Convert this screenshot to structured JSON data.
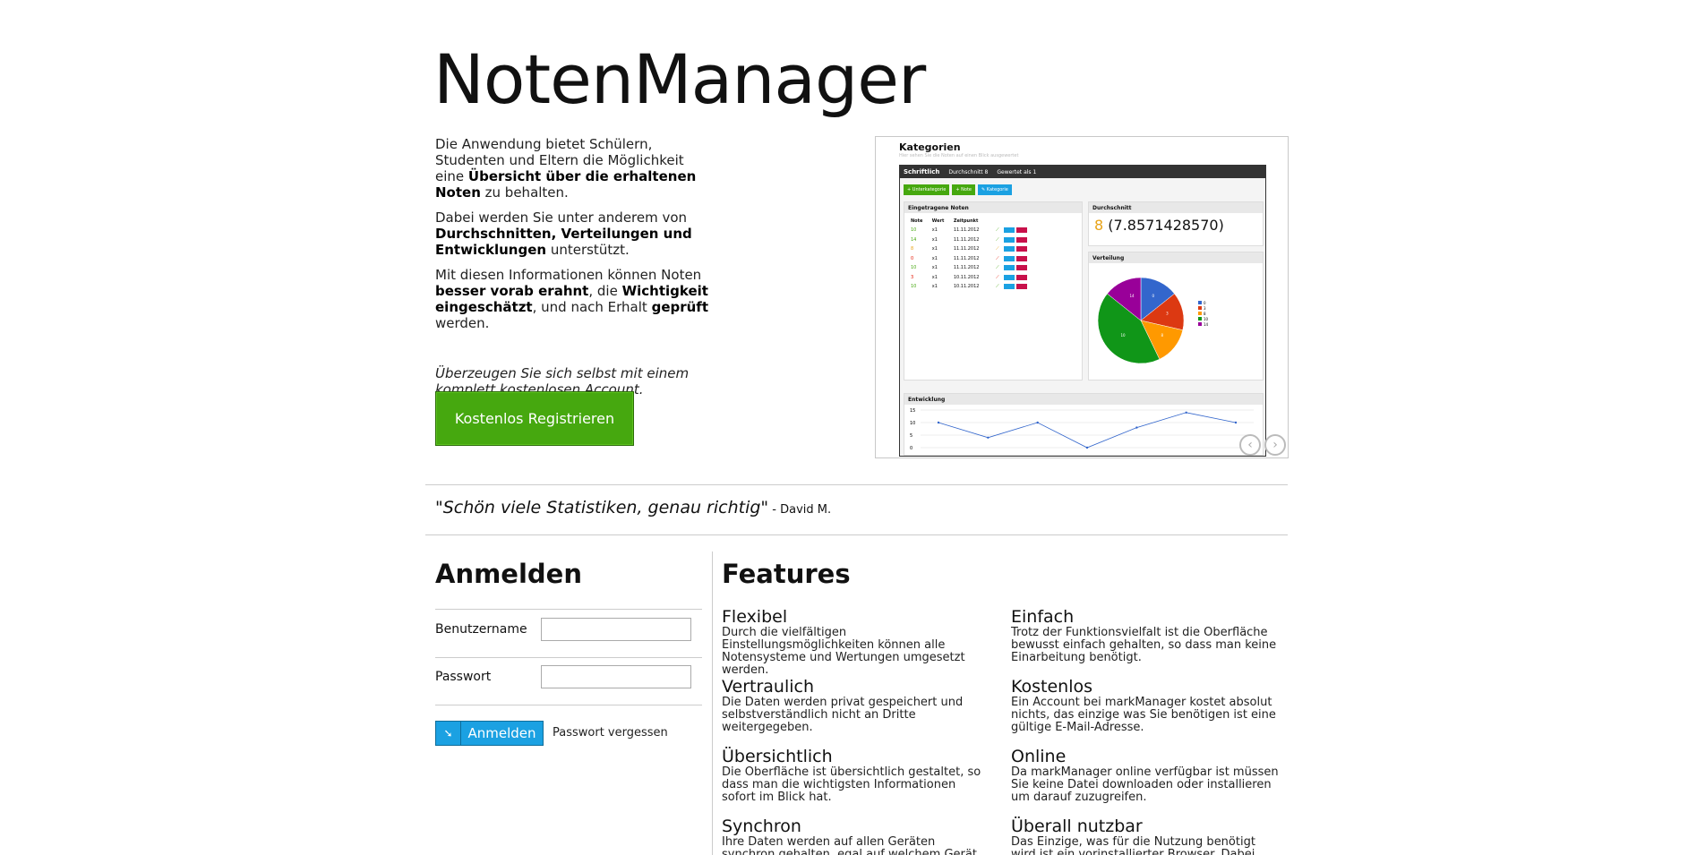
{
  "header": {
    "title": "NotenManager"
  },
  "intro": {
    "p1": [
      "Die Anwendung bietet Schülern, Studenten und Eltern die Möglichkeit eine ",
      "Übersicht über die erhaltenen Noten",
      " zu behalten."
    ],
    "p2": [
      "Dabei werden Sie unter anderem von ",
      "Durchschnitten, Verteilungen und Entwicklungen",
      " unterstützt."
    ],
    "p3": [
      "Mit diesen Informationen können Noten ",
      "besser vorab erahnt",
      ", die ",
      "Wichtigkeit eingeschätzt",
      ", und nach Erhalt ",
      "geprüft",
      " werden."
    ],
    "convince": "Überzeugen Sie sich selbst mit einem komplett kostenlosen Account.",
    "register_label": "Kostenlos Registrieren"
  },
  "preview": {
    "title": "Kategorien",
    "subtitle": "Hier sehen Sie die Noten auf einen Blick ausgewertet",
    "bar": {
      "name": "Schriftlich",
      "avg": "Durchschnitt 8",
      "weight": "Gewertet als 1"
    },
    "buttons": [
      "Unterkategorie",
      "Note",
      "Kategorie"
    ],
    "grades_panel": "Eingetragene Noten",
    "headers": [
      "Note",
      "Wert",
      "Zeitpunkt"
    ],
    "rows": [
      {
        "note": "10",
        "wert": "x1",
        "zeit": "11.11.2012",
        "color": "#46a80f"
      },
      {
        "note": "14",
        "wert": "x1",
        "zeit": "11.11.2012",
        "color": "#46a80f"
      },
      {
        "note": "8",
        "wert": "x1",
        "zeit": "11.11.2012",
        "color": "#e8a317"
      },
      {
        "note": "0",
        "wert": "x1",
        "zeit": "11.11.2012",
        "color": "#e51400"
      },
      {
        "note": "10",
        "wert": "x1",
        "zeit": "11.11.2012",
        "color": "#46a80f"
      },
      {
        "note": "3",
        "wert": "x1",
        "zeit": "10.11.2012",
        "color": "#e51400"
      },
      {
        "note": "10",
        "wert": "x1",
        "zeit": "10.11.2012",
        "color": "#46a80f"
      }
    ],
    "avg_panel": "Durchschnitt",
    "avg_value": "8",
    "avg_exact": "(7.8571428570)",
    "dist_panel": "Verteilung",
    "dist_slices": [
      {
        "label": "0",
        "value": 1,
        "color": "#3366cc"
      },
      {
        "label": "3",
        "value": 1,
        "color": "#dc3912"
      },
      {
        "label": "8",
        "value": 1,
        "color": "#ff9900"
      },
      {
        "label": "10",
        "value": 3,
        "color": "#109618"
      },
      {
        "label": "14",
        "value": 1,
        "color": "#990099"
      }
    ],
    "dev_panel": "Entwicklung",
    "dev_ticks": [
      "15",
      "10",
      "5",
      "0"
    ],
    "dev_values": [
      10,
      4,
      10,
      0,
      8,
      14,
      10
    ]
  },
  "quote": {
    "text": "\"Schön viele Statistiken, genau richtig\"",
    "author": " - David M."
  },
  "login": {
    "heading": "Anmelden",
    "username_label": "Benutzername",
    "password_label": "Passwort",
    "button_label": "Anmelden",
    "forgot_label": "Passwort vergessen"
  },
  "features": {
    "heading": "Features",
    "items": [
      {
        "title": "Flexibel",
        "text": "Durch die vielfältigen Einstellungsmöglichkeiten können alle Notensysteme und Wertungen umgesetzt werden."
      },
      {
        "title": "Einfach",
        "text": "Trotz der Funktionsvielfalt ist die Oberfläche bewusst einfach gehalten, so dass man keine Einarbeitung benötigt."
      },
      {
        "title": "Vertraulich",
        "text": "Die Daten werden privat gespeichert und selbstverständlich nicht an Dritte weitergegeben."
      },
      {
        "title": "Kostenlos",
        "text": "Ein Account bei markManager kostet absolut nichts, das einzige was Sie benötigen ist eine gültige E-Mail-Adresse."
      },
      {
        "title": "Übersichtlich",
        "text": "Die Oberfläche ist übersichtlich gestaltet, so dass man die wichtigsten Informationen sofort im Blick hat."
      },
      {
        "title": "Online",
        "text": "Da markManager online verfügbar ist müssen Sie keine Datei downloaden oder installieren um darauf zuzugreifen."
      },
      {
        "title": "Synchron",
        "text": "Ihre Daten werden auf allen Geräten synchron gehalten, egal auf welchem Gerät Sie sich in"
      },
      {
        "title": "Überall nutzbar",
        "text": "Das Einzige, was für die Nutzung benötigt wird ist ein vorinstallierter Browser. Dabei werden"
      }
    ]
  },
  "colors": {
    "green": "#46a80f",
    "blue": "#1ba1e2"
  }
}
